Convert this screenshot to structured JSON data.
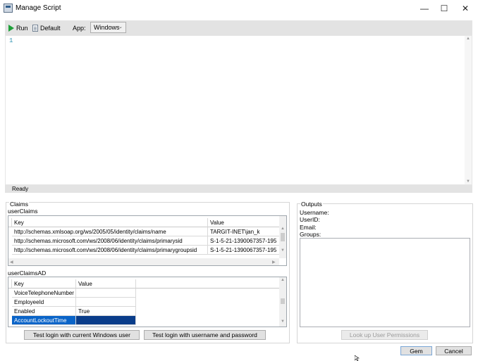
{
  "window": {
    "title": "Manage Script",
    "icon": "script-window-icon",
    "controls": {
      "minimize": "—",
      "maximize": "☐",
      "close": "✕"
    }
  },
  "toolbar": {
    "run_label": "Run",
    "default_label": "Default",
    "app_label": "App:",
    "app_value": "Windows",
    "app_chevron": "⌄"
  },
  "editor": {
    "line_numbers": [
      "1"
    ],
    "content": ""
  },
  "status": {
    "text": "Ready"
  },
  "claims": {
    "group_label": "Claims",
    "user_claims": {
      "label": "userClaims",
      "columns": [
        "Key",
        "Value"
      ],
      "rows": [
        {
          "key": "http://schemas.xmlsoap.org/ws/2005/05/identity/claims/name",
          "value": "TARGIT-INET\\jan_k"
        },
        {
          "key": "http://schemas.microsoft.com/ws/2008/06/identity/claims/primarysid",
          "value": "S-1-5-21-1390067357-195"
        },
        {
          "key": "http://schemas.microsoft.com/ws/2008/06/identity/claims/primarygroupsid",
          "value": "S-1-5-21-1390067357-195"
        }
      ]
    },
    "user_claims_ad": {
      "label": "userClaimsAD",
      "columns": [
        "Key",
        "Value"
      ],
      "rows": [
        {
          "key": "VoiceTelephoneNumber",
          "value": ""
        },
        {
          "key": "EmployeeId",
          "value": ""
        },
        {
          "key": "Enabled",
          "value": "True"
        },
        {
          "key": "AccountLockoutTime",
          "value": ""
        }
      ],
      "selected_row": "AccountLockoutTime"
    },
    "buttons": {
      "test_windows": "Test login with current Windows user",
      "test_userpass": "Test login with username and password"
    }
  },
  "outputs": {
    "group_label": "Outputs",
    "username_label": "Username:",
    "userid_label": "UserID:",
    "email_label": "Email:",
    "groups_label": "Groups:",
    "lookup_button": "Look up User Permissions",
    "lookup_enabled": false
  },
  "footer": {
    "save_label": "Gem",
    "cancel_label": "Cancel"
  },
  "colors": {
    "run_green": "#1fa03a",
    "selection_blue": "#0a64c8",
    "toolbar_gray": "#e3e3e3"
  }
}
